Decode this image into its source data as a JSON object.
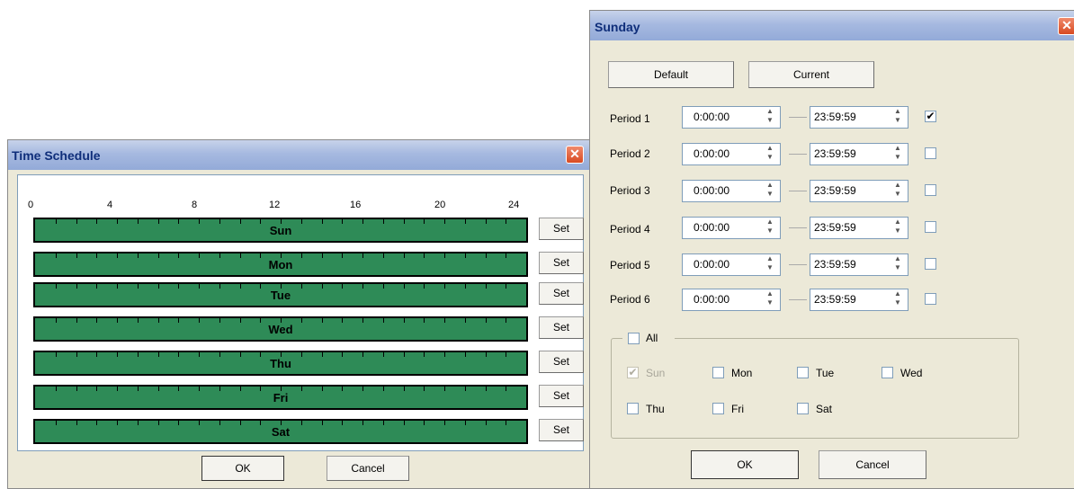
{
  "schedule": {
    "title": "Time Schedule",
    "close_glyph": "✕",
    "ruler": [
      "0",
      "4",
      "8",
      "12",
      "16",
      "20",
      "24"
    ],
    "days": [
      {
        "label": "Sun",
        "set": "Set"
      },
      {
        "label": "Mon",
        "set": "Set"
      },
      {
        "label": "Tue",
        "set": "Set"
      },
      {
        "label": "Wed",
        "set": "Set"
      },
      {
        "label": "Thu",
        "set": "Set"
      },
      {
        "label": "Fri",
        "set": "Set"
      },
      {
        "label": "Sat",
        "set": "Set"
      }
    ],
    "ok": "OK",
    "cancel": "Cancel",
    "bar_color": "#2e8b57"
  },
  "sunday": {
    "title": "Sunday",
    "close_glyph": "✕",
    "default_btn": "Default",
    "current_btn": "Current",
    "periods": [
      {
        "label": "Period 1",
        "start": "0:00:00",
        "end": "23:59:59",
        "checked": "✔"
      },
      {
        "label": "Period 2",
        "start": "0:00:00",
        "end": "23:59:59",
        "checked": ""
      },
      {
        "label": "Period 3",
        "start": "0:00:00",
        "end": "23:59:59",
        "checked": ""
      },
      {
        "label": "Period 4",
        "start": "0:00:00",
        "end": "23:59:59",
        "checked": ""
      },
      {
        "label": "Period 5",
        "start": "0:00:00",
        "end": "23:59:59",
        "checked": ""
      },
      {
        "label": "Period 6",
        "start": "0:00:00",
        "end": "23:59:59",
        "checked": ""
      }
    ],
    "all_label": "All",
    "days": {
      "sun": "Sun",
      "mon": "Mon",
      "tue": "Tue",
      "wed": "Wed",
      "thu": "Thu",
      "fri": "Fri",
      "sat": "Sat",
      "sun_check": "✔"
    },
    "ok": "OK",
    "cancel": "Cancel"
  }
}
